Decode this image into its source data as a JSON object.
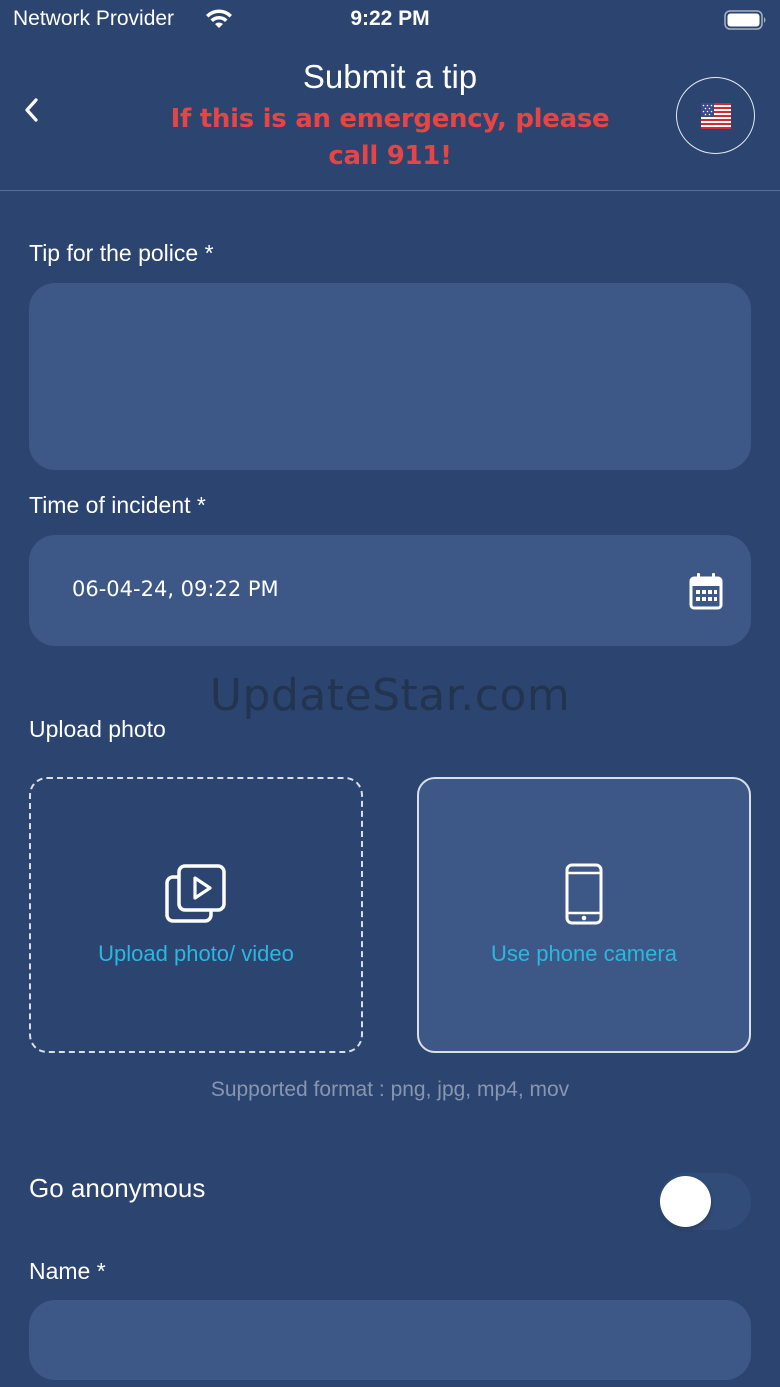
{
  "status_bar": {
    "carrier": "Network Provider",
    "time": "9:22 PM"
  },
  "header": {
    "title": "Submit a tip",
    "warning": "If this is an emergency, please call 911!",
    "back_icon": "chevron-left-icon",
    "language_icon": "us-flag-icon"
  },
  "form": {
    "tip_label": "Tip for the police *",
    "tip_value": "",
    "time_label": "Time of incident *",
    "time_value": "06-04-24, 09:22 PM",
    "upload_label": "Upload photo",
    "upload_button_label": "Upload photo/ video",
    "camera_button_label": "Use phone camera",
    "supported_format": "Supported format : png, jpg, mp4, mov",
    "anonymous_label": "Go anonymous",
    "anonymous_on": false,
    "name_label": "Name *",
    "name_value": ""
  },
  "watermark": "UpdateStar.com",
  "colors": {
    "background": "#2c4470",
    "field": "#3d5886",
    "warning": "#e64545",
    "accent": "#2ab7e0"
  }
}
